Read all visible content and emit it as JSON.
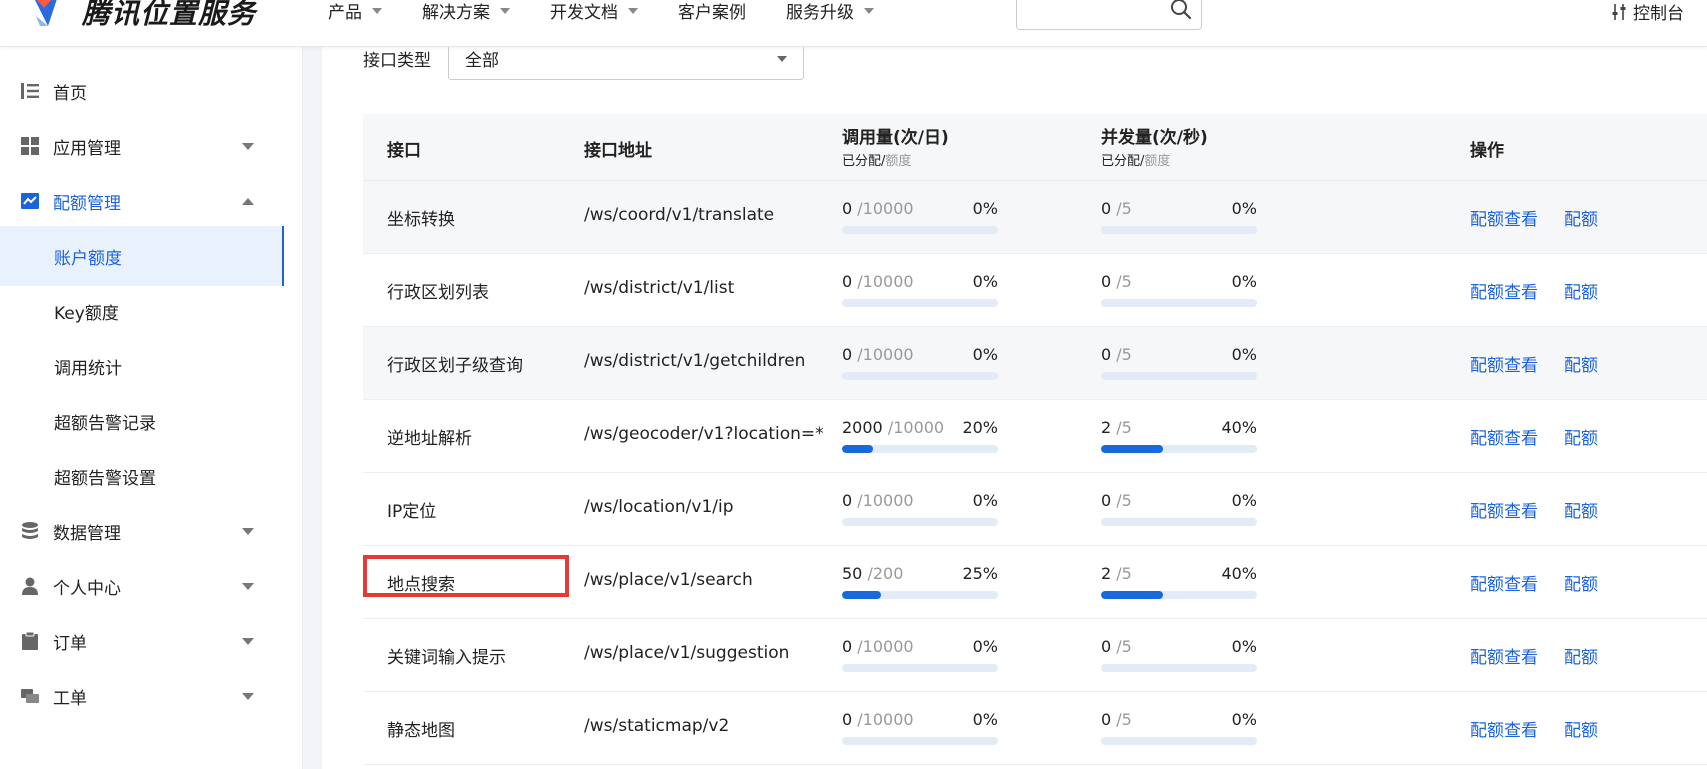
{
  "header": {
    "brand": "腾讯位置服务",
    "nav": [
      {
        "label": "产品",
        "dropdown": true
      },
      {
        "label": "解决方案",
        "dropdown": true
      },
      {
        "label": "开发文档",
        "dropdown": true
      },
      {
        "label": "客户案例",
        "dropdown": false
      },
      {
        "label": "服务升级",
        "dropdown": true
      }
    ],
    "search_value": "",
    "console_label": "控制台"
  },
  "sidebar": {
    "items": [
      {
        "label": "首页",
        "icon": "list-icon"
      },
      {
        "label": "应用管理",
        "icon": "grid-icon",
        "arrow": "down"
      },
      {
        "label": "配额管理",
        "icon": "chart-icon",
        "arrow": "up",
        "active": true
      },
      {
        "label": "账户额度",
        "sub": true,
        "selected": true
      },
      {
        "label": "Key额度",
        "sub": true
      },
      {
        "label": "调用统计",
        "sub": true
      },
      {
        "label": "超额告警记录",
        "sub": true
      },
      {
        "label": "超额告警设置",
        "sub": true
      },
      {
        "label": "数据管理",
        "icon": "database-icon",
        "arrow": "down"
      },
      {
        "label": "个人中心",
        "icon": "user-icon",
        "arrow": "down"
      },
      {
        "label": "订单",
        "icon": "clipboard-icon",
        "arrow": "down"
      },
      {
        "label": "工单",
        "icon": "chat-icon",
        "arrow": "down"
      }
    ]
  },
  "filter": {
    "label": "接口类型",
    "selected": "全部"
  },
  "table": {
    "headers": {
      "api": "接口",
      "path": "接口地址",
      "calls": "调用量(次/日)",
      "concurrency": "并发量(次/秒)",
      "sub_allocated": "已分配/",
      "sub_quota": "额度",
      "actions": "操作"
    },
    "action_labels": [
      "配额查看",
      "配额"
    ],
    "colors": {
      "bar_fill": "#1769e0",
      "bar_track": "#e3ebf7",
      "link": "#1a63d8"
    },
    "rows": [
      {
        "name": "坐标转换",
        "path": "/ws/coord/v1/translate",
        "calls_used": "0",
        "calls_total": "/10000",
        "calls_pct": "0%",
        "calls_fill": 0,
        "conc_used": "0",
        "conc_total": "/5",
        "conc_pct": "0%",
        "conc_fill": 0
      },
      {
        "name": "行政区划列表",
        "path": "/ws/district/v1/list",
        "calls_used": "0",
        "calls_total": "/10000",
        "calls_pct": "0%",
        "calls_fill": 0,
        "conc_used": "0",
        "conc_total": "/5",
        "conc_pct": "0%",
        "conc_fill": 0
      },
      {
        "name": "行政区划子级查询",
        "path": "/ws/district/v1/getchildren",
        "calls_used": "0",
        "calls_total": "/10000",
        "calls_pct": "0%",
        "calls_fill": 0,
        "conc_used": "0",
        "conc_total": "/5",
        "conc_pct": "0%",
        "conc_fill": 0
      },
      {
        "name": "逆地址解析",
        "path": "/ws/geocoder/v1?location=*",
        "calls_used": "2000",
        "calls_total": "/10000",
        "calls_pct": "20%",
        "calls_fill": 20,
        "conc_used": "2",
        "conc_total": "/5",
        "conc_pct": "40%",
        "conc_fill": 40
      },
      {
        "name": "IP定位",
        "path": "/ws/location/v1/ip",
        "calls_used": "0",
        "calls_total": "/10000",
        "calls_pct": "0%",
        "calls_fill": 0,
        "conc_used": "0",
        "conc_total": "/5",
        "conc_pct": "0%",
        "conc_fill": 0
      },
      {
        "name": "地点搜索",
        "path": "/ws/place/v1/search",
        "calls_used": "50",
        "calls_total": "/200",
        "calls_pct": "25%",
        "calls_fill": 25,
        "conc_used": "2",
        "conc_total": "/5",
        "conc_pct": "40%",
        "conc_fill": 40
      },
      {
        "name": "关键词输入提示",
        "path": "/ws/place/v1/suggestion",
        "calls_used": "0",
        "calls_total": "/10000",
        "calls_pct": "0%",
        "calls_fill": 0,
        "conc_used": "0",
        "conc_total": "/5",
        "conc_pct": "0%",
        "conc_fill": 0
      },
      {
        "name": "静态地图",
        "path": "/ws/staticmap/v2",
        "calls_used": "0",
        "calls_total": "/10000",
        "calls_pct": "0%",
        "calls_fill": 0,
        "conc_used": "0",
        "conc_total": "/5",
        "conc_pct": "0%",
        "conc_fill": 0
      }
    ]
  }
}
